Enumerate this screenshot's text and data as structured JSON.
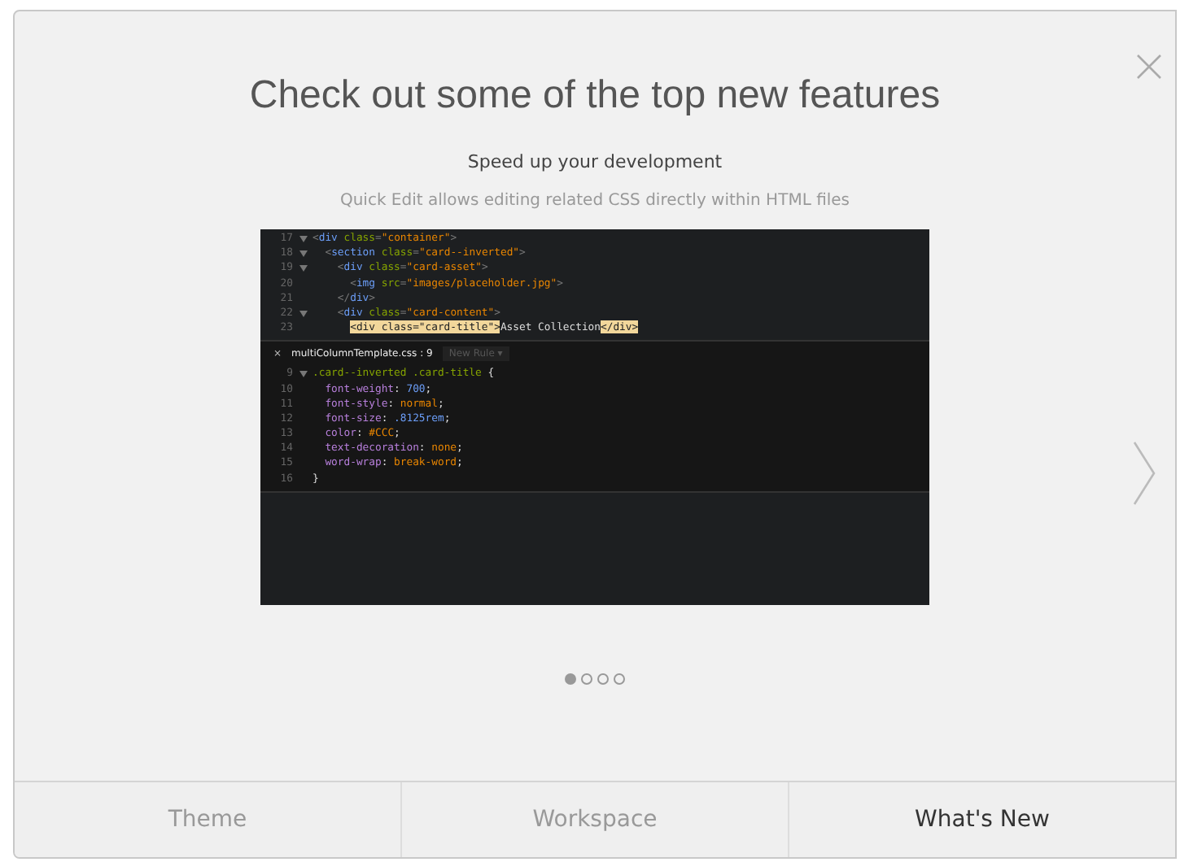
{
  "title": "Check out some of the top new features",
  "slide": {
    "heading": "Speed up your development",
    "description": "Quick Edit allows editing related CSS directly within HTML files",
    "editor": {
      "lines": [
        {
          "number": "17",
          "foldable": true,
          "segments": [
            {
              "kind": "punct",
              "text": "<"
            },
            {
              "kind": "tag",
              "text": "div"
            },
            {
              "kind": "attr",
              "text": " class"
            },
            {
              "kind": "punct",
              "text": "="
            },
            {
              "kind": "string",
              "text": "\"container\""
            },
            {
              "kind": "punct",
              "text": ">"
            }
          ]
        },
        {
          "number": "18",
          "foldable": true,
          "segments": [
            {
              "kind": "punct",
              "text": "  <"
            },
            {
              "kind": "tag",
              "text": "section"
            },
            {
              "kind": "attr",
              "text": " class"
            },
            {
              "kind": "punct",
              "text": "="
            },
            {
              "kind": "string",
              "text": "\"card--inverted\""
            },
            {
              "kind": "punct",
              "text": ">"
            }
          ]
        },
        {
          "number": "19",
          "foldable": true,
          "segments": [
            {
              "kind": "punct",
              "text": "    <"
            },
            {
              "kind": "tag",
              "text": "div"
            },
            {
              "kind": "attr",
              "text": " class"
            },
            {
              "kind": "punct",
              "text": "="
            },
            {
              "kind": "string",
              "text": "\"card-asset\""
            },
            {
              "kind": "punct",
              "text": ">"
            }
          ]
        },
        {
          "number": "20",
          "foldable": false,
          "segments": [
            {
              "kind": "punct",
              "text": "      <"
            },
            {
              "kind": "tag",
              "text": "img"
            },
            {
              "kind": "attr",
              "text": " src"
            },
            {
              "kind": "punct",
              "text": "="
            },
            {
              "kind": "string",
              "text": "\"images/placeholder.jpg\""
            },
            {
              "kind": "punct",
              "text": ">"
            }
          ]
        },
        {
          "number": "21",
          "foldable": false,
          "segments": [
            {
              "kind": "punct",
              "text": "    </"
            },
            {
              "kind": "tag",
              "text": "div"
            },
            {
              "kind": "punct",
              "text": ">"
            }
          ]
        },
        {
          "number": "22",
          "foldable": true,
          "segments": [
            {
              "kind": "punct",
              "text": "    <"
            },
            {
              "kind": "tag",
              "text": "div"
            },
            {
              "kind": "attr",
              "text": " class"
            },
            {
              "kind": "punct",
              "text": "="
            },
            {
              "kind": "string",
              "text": "\"card-content\""
            },
            {
              "kind": "punct",
              "text": ">"
            }
          ]
        },
        {
          "number": "23",
          "foldable": false,
          "segments": [
            {
              "kind": "match",
              "text": "      <div class=\"card-title\">"
            },
            {
              "kind": "text",
              "text": "Asset Collection"
            },
            {
              "kind": "match",
              "text": "</div>"
            }
          ]
        }
      ],
      "inline_editor": {
        "close": "×",
        "file": "multiColumnTemplate.css : 9",
        "new_rule": "New Rule ▾",
        "lines": [
          {
            "number": "9",
            "foldable": true,
            "segments": [
              {
                "kind": "selector",
                "text": ".card--inverted .card-title"
              },
              {
                "kind": "text",
                "text": " {"
              }
            ]
          },
          {
            "number": "10",
            "foldable": false,
            "segments": [
              {
                "kind": "property",
                "text": "  font-weight"
              },
              {
                "kind": "text",
                "text": ": "
              },
              {
                "kind": "number",
                "text": "700"
              },
              {
                "kind": "text",
                "text": ";"
              }
            ]
          },
          {
            "number": "11",
            "foldable": false,
            "segments": [
              {
                "kind": "property",
                "text": "  font-style"
              },
              {
                "kind": "text",
                "text": ": "
              },
              {
                "kind": "value",
                "text": "normal"
              },
              {
                "kind": "text",
                "text": ";"
              }
            ]
          },
          {
            "number": "12",
            "foldable": false,
            "segments": [
              {
                "kind": "property",
                "text": "  font-size"
              },
              {
                "kind": "text",
                "text": ": "
              },
              {
                "kind": "number",
                "text": ".8125rem"
              },
              {
                "kind": "text",
                "text": ";"
              }
            ]
          },
          {
            "number": "13",
            "foldable": false,
            "segments": [
              {
                "kind": "property",
                "text": "  color"
              },
              {
                "kind": "text",
                "text": ": "
              },
              {
                "kind": "value",
                "text": "#CCC"
              },
              {
                "kind": "text",
                "text": ";"
              }
            ]
          },
          {
            "number": "14",
            "foldable": false,
            "segments": [
              {
                "kind": "property",
                "text": "  text-decoration"
              },
              {
                "kind": "text",
                "text": ": "
              },
              {
                "kind": "value",
                "text": "none"
              },
              {
                "kind": "text",
                "text": ";"
              }
            ]
          },
          {
            "number": "15",
            "foldable": false,
            "segments": [
              {
                "kind": "property",
                "text": "  word-wrap"
              },
              {
                "kind": "text",
                "text": ": "
              },
              {
                "kind": "value",
                "text": "break-word"
              },
              {
                "kind": "text",
                "text": ";"
              }
            ]
          },
          {
            "number": "16",
            "foldable": false,
            "segments": [
              {
                "kind": "text",
                "text": "}"
              }
            ]
          }
        ]
      }
    }
  },
  "pager": [
    {
      "selected": true
    },
    {
      "selected": false
    },
    {
      "selected": false
    },
    {
      "selected": false
    }
  ],
  "steps": [
    {
      "label": "Theme",
      "selected": false
    },
    {
      "label": "Workspace",
      "selected": false
    },
    {
      "label": "What's New",
      "selected": true
    }
  ]
}
